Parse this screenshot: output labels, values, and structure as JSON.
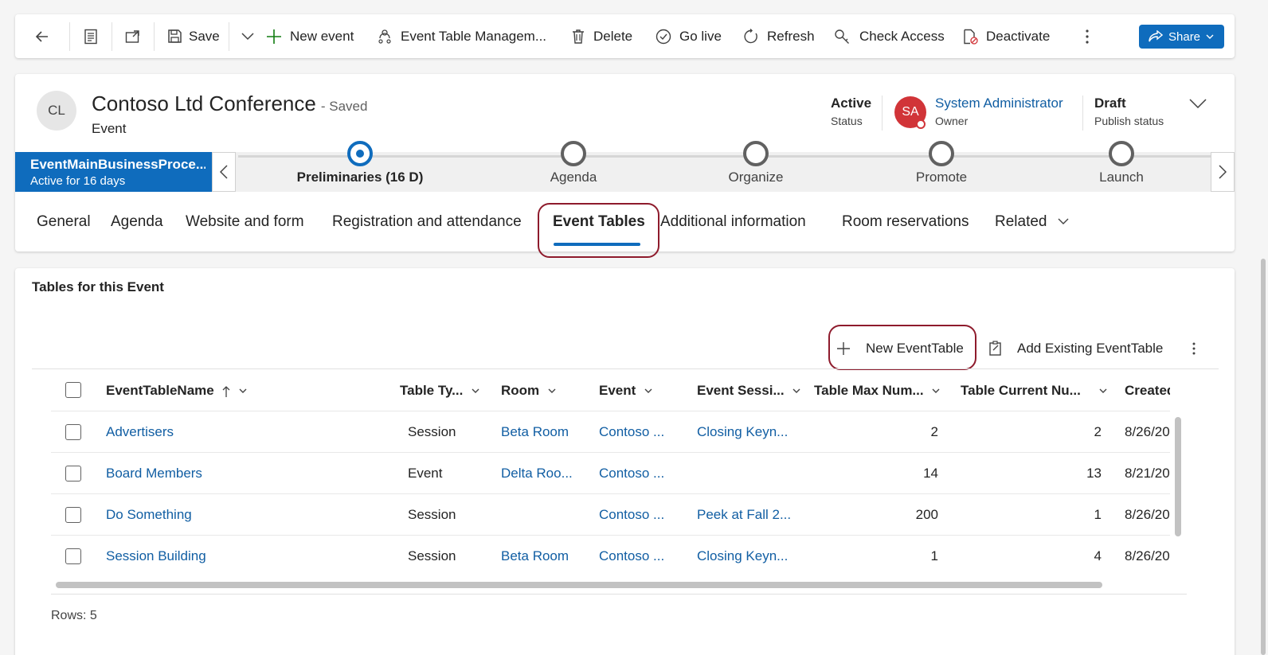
{
  "commandbar": {
    "save": "Save",
    "new_event": "New event",
    "event_table_management": "Event Table Managem...",
    "delete": "Delete",
    "go_live": "Go live",
    "refresh": "Refresh",
    "check_access": "Check Access",
    "deactivate": "Deactivate",
    "share": "Share"
  },
  "record": {
    "initials": "CL",
    "title": "Contoso Ltd Conference",
    "saved_state": "- Saved",
    "entity": "Event",
    "status_value": "Active",
    "status_label": "Status",
    "owner_initials": "SA",
    "owner_name": "System Administrator",
    "owner_label": "Owner",
    "publish_value": "Draft",
    "publish_label": "Publish status"
  },
  "process": {
    "name": "EventMainBusinessProce...",
    "duration": "Active for 16 days",
    "stages": [
      {
        "label": "Preliminaries  (16 D)"
      },
      {
        "label": "Agenda"
      },
      {
        "label": "Organize"
      },
      {
        "label": "Promote"
      },
      {
        "label": "Launch"
      }
    ]
  },
  "tabs": [
    {
      "label": "General"
    },
    {
      "label": "Agenda"
    },
    {
      "label": "Website and form"
    },
    {
      "label": "Registration and attendance"
    },
    {
      "label": "Event Tables"
    },
    {
      "label": "Additional information"
    },
    {
      "label": "Room reservations"
    },
    {
      "label": "Related"
    }
  ],
  "subgrid": {
    "title": "Tables for this Event",
    "new_button": "New EventTable",
    "add_existing_button": "Add Existing EventTable",
    "columns": [
      {
        "label": "EventTableName"
      },
      {
        "label": "Table Ty..."
      },
      {
        "label": "Room"
      },
      {
        "label": "Event"
      },
      {
        "label": "Event Sessi..."
      },
      {
        "label": "Table Max Num..."
      },
      {
        "label": "Table Current Nu..."
      },
      {
        "label": "Created O"
      }
    ],
    "rows": [
      {
        "name": "Advertisers",
        "type": "Session",
        "room": "Beta Room",
        "event": "Contoso ...",
        "session": "Closing Keyn...",
        "max": "2",
        "current": "2",
        "created": "8/26/20"
      },
      {
        "name": "Board Members",
        "type": "Event",
        "room": "Delta Roo...",
        "event": "Contoso ...",
        "session": "",
        "max": "14",
        "current": "13",
        "created": "8/21/20"
      },
      {
        "name": "Do Something",
        "type": "Session",
        "room": "",
        "event": "Contoso ...",
        "session": "Peek at Fall 2...",
        "max": "200",
        "current": "1",
        "created": "8/26/20"
      },
      {
        "name": "Session Building",
        "type": "Session",
        "room": "Beta Room",
        "event": "Contoso ...",
        "session": "Closing Keyn...",
        "max": "1",
        "current": "4",
        "created": "8/26/20"
      }
    ],
    "rows_count": "Rows: 5"
  }
}
